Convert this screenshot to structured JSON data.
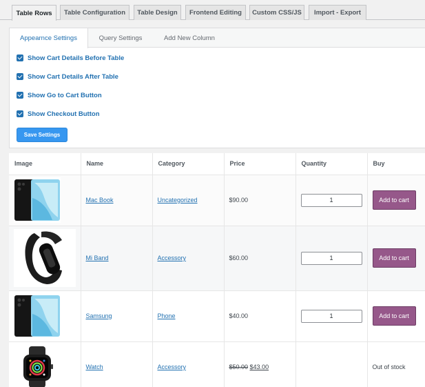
{
  "top_tabs": [
    {
      "label": "Table Rows",
      "active": true
    },
    {
      "label": "Table Configuration",
      "active": false
    },
    {
      "label": "Table Design",
      "active": false
    },
    {
      "label": "Frontend Editing",
      "active": false
    },
    {
      "label": "Custom CSS/JS",
      "active": false
    },
    {
      "label": "Import - Export",
      "active": false
    }
  ],
  "sub_tabs": [
    {
      "label": "Appearnce Settings",
      "active": true
    },
    {
      "label": "Query Settings",
      "active": false
    },
    {
      "label": "Add New Column",
      "active": false
    }
  ],
  "settings": [
    {
      "label": "Show Cart Details Before Table",
      "checked": true
    },
    {
      "label": "Show Cart Details After Table",
      "checked": true
    },
    {
      "label": "Show Go to Cart Button",
      "checked": true
    },
    {
      "label": "Show Checkout Button",
      "checked": true
    }
  ],
  "save_label": "Save Settings",
  "table": {
    "headers": [
      "Image",
      "Name",
      "Category",
      "Price",
      "Quantity",
      "Buy"
    ],
    "rows": [
      {
        "image": "phone-image",
        "name": "Mac Book",
        "category": "Uncategorized",
        "price": "$90.00",
        "qty": "1",
        "buy": "Add to cart"
      },
      {
        "image": "band-image",
        "name": "Mi Band",
        "category": "Accessory",
        "price": "$60.00",
        "qty": "1",
        "buy": "Add to cart"
      },
      {
        "image": "phone-image",
        "name": "Samsung",
        "category": "Phone",
        "price": "$40.00",
        "qty": "1",
        "buy": "Add to cart"
      },
      {
        "image": "watch-image",
        "name": "Watch",
        "category": "Accessory",
        "old_price": "$50.00",
        "sale_price": "$43.00",
        "buy": "Out of stock"
      }
    ]
  },
  "colors": {
    "accent": "#2271b1",
    "cart_button": "#96588a",
    "save_button": "#3797f0"
  }
}
